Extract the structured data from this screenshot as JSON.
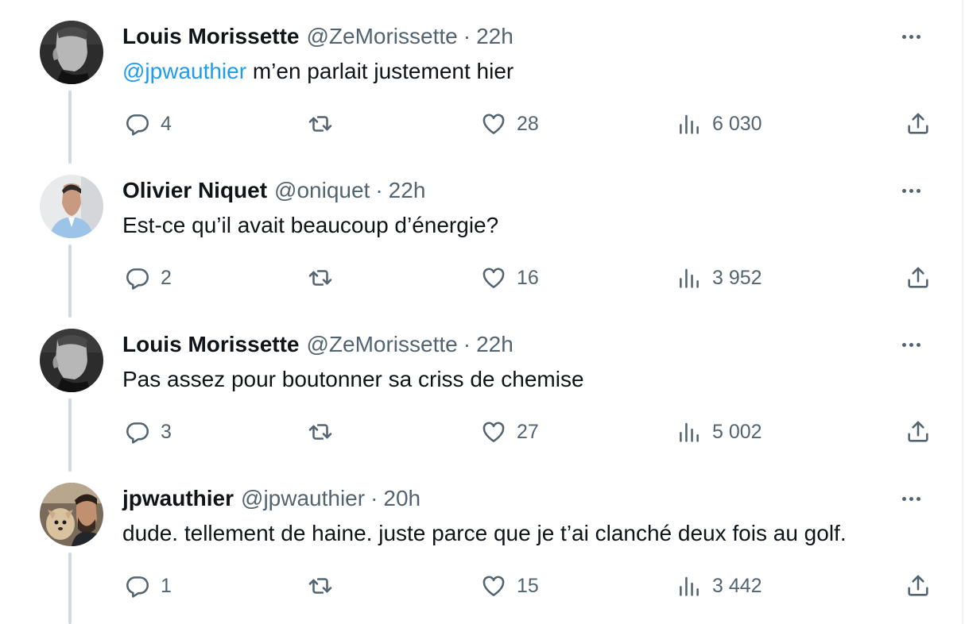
{
  "tweets": [
    {
      "name": "Louis Morissette",
      "handle": "@ZeMorissette",
      "separator": "·",
      "time": "22h",
      "mention": "@jpwauthier",
      "text": " m’en parlait justement hier",
      "replies": "4",
      "retweets": "",
      "likes": "28",
      "views": "6 030",
      "avatar": "grayscale-portrait-profile"
    },
    {
      "name": "Olivier Niquet",
      "handle": "@oniquet",
      "separator": "·",
      "time": "22h",
      "text": "Est-ce qu’il avait beaucoup d’énergie?",
      "replies": "2",
      "retweets": "",
      "likes": "16",
      "views": "3 952",
      "avatar": "man-in-light-blue-shirt"
    },
    {
      "name": "Louis Morissette",
      "handle": "@ZeMorissette",
      "separator": "·",
      "time": "22h",
      "text": "Pas assez pour boutonner sa criss de chemise",
      "replies": "3",
      "retweets": "",
      "likes": "27",
      "views": "5 002",
      "avatar": "grayscale-portrait-profile"
    },
    {
      "name": "jpwauthier",
      "handle": "@jpwauthier",
      "separator": "·",
      "time": "20h",
      "text": "dude. tellement de haine. juste parce que je t’ai clanché deux fois au golf.",
      "replies": "1",
      "retweets": "",
      "likes": "15",
      "views": "3 442",
      "avatar": "man-with-small-dog"
    }
  ],
  "colors": {
    "text": "#0f1419",
    "secondary": "#536471",
    "link": "#1d9bf0",
    "thread_line": "#cfd9de"
  },
  "icons": [
    "reply-icon",
    "retweet-icon",
    "like-icon",
    "views-icon",
    "share-icon",
    "more-icon"
  ]
}
